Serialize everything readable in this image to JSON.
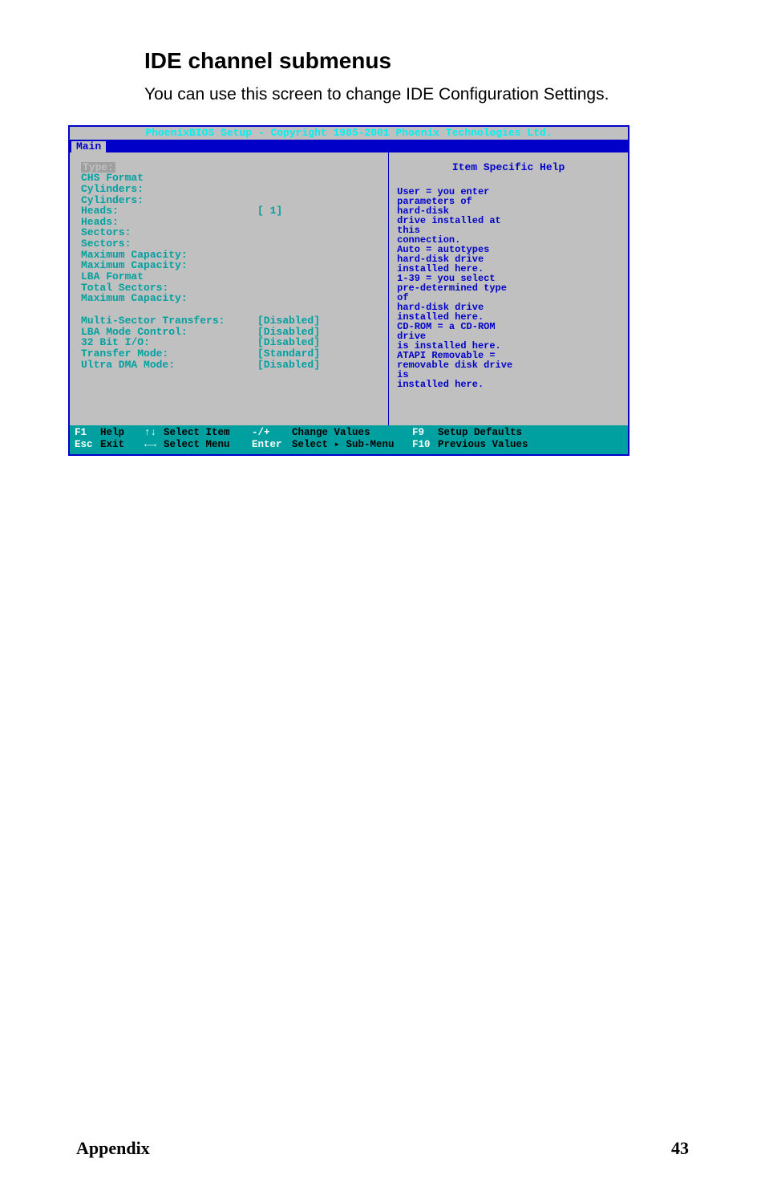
{
  "heading": "IDE channel submenus",
  "intro": "You can use this screen to change IDE Configuration Settings.",
  "bios": {
    "title": "PhoenixBIOS Setup - Copyright 1985-2001 Phoenix Technologies Ltd.",
    "tab": "Main",
    "left": {
      "type_label": "Type:",
      "rows": [
        {
          "label": "CHS Format",
          "value": ""
        },
        {
          "label": "Cylinders:",
          "value": ""
        },
        {
          "label": "Cylinders:",
          "value": ""
        },
        {
          "label": "Heads:",
          "value": "[  1]"
        },
        {
          "label": "Heads:",
          "value": ""
        },
        {
          "label": "Sectors:",
          "value": ""
        },
        {
          "label": "Sectors:",
          "value": ""
        },
        {
          "label": "Maximum Capacity:",
          "value": ""
        },
        {
          "label": "Maximum Capacity:",
          "value": ""
        },
        {
          "label": "LBA Format",
          "value": ""
        },
        {
          "label": "Total Sectors:",
          "value": ""
        },
        {
          "label": "Maximum Capacity:",
          "value": ""
        }
      ],
      "settings": [
        {
          "label": "Multi-Sector Transfers:",
          "value": "[Disabled]"
        },
        {
          "label": "LBA Mode Control:",
          "value": "[Disabled]"
        },
        {
          "label": "32 Bit I/O:",
          "value": "[Disabled]"
        },
        {
          "label": "Transfer Mode:",
          "value": "[Standard]"
        },
        {
          "label": "Ultra DMA Mode:",
          "value": "[Disabled]"
        }
      ]
    },
    "right": {
      "title": "Item Specific Help",
      "text": "User = you enter\nparameters of\nhard-disk\ndrive installed at\nthis\nconnection.\nAuto = autotypes\nhard-disk drive\ninstalled here.\n1-39 = you select\npre-determined  type\nof\nhard-disk drive\ninstalled here.\nCD-ROM = a CD-ROM\ndrive\nis installed here.\nATAPI Removable =\nremovable disk drive\nis\ninstalled here."
    },
    "footer": {
      "f1": "F1",
      "help": "Help",
      "updown": "↑↓",
      "select_item": "Select Item",
      "pm": "-/+",
      "change_values": "Change Values",
      "f9": "F9",
      "setup_defaults": "Setup Defaults",
      "esc": "Esc",
      "exit": "Exit",
      "lr": "←→",
      "select_menu": "Select Menu",
      "enter": "Enter",
      "select_sub": "Select ▸ Sub-Menu",
      "f10": "F10",
      "previous_values": "Previous Values"
    }
  },
  "footer": {
    "appendix": "Appendix",
    "page": "43"
  }
}
